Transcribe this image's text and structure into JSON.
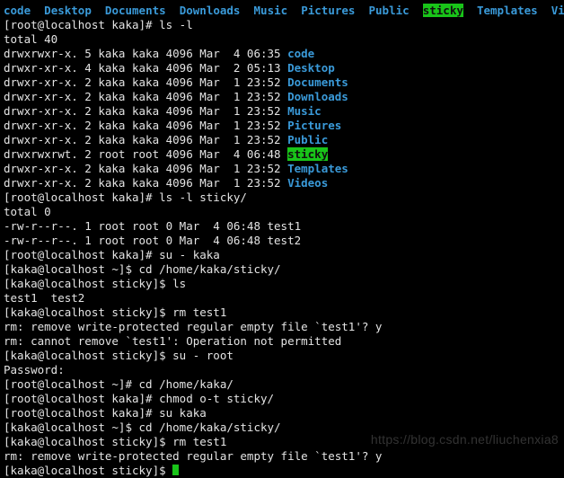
{
  "header_dirs": [
    "code",
    "Desktop",
    "Documents",
    "Downloads",
    "Music",
    "Pictures",
    "Public",
    "sticky",
    "Templates",
    "Videos"
  ],
  "prompts": {
    "root_kaka": "[root@localhost kaka]# ",
    "root_home": "[root@localhost ~]# ",
    "kaka_home": "[kaka@localhost ~]$ ",
    "kaka_sticky": "[kaka@localhost sticky]$ "
  },
  "cmds": {
    "ls_l": "ls -l",
    "ls_l_sticky": "ls -l sticky/",
    "su_kaka": "su - kaka",
    "cd_sticky_full": "cd /home/kaka/sticky/",
    "ls": "ls",
    "rm_test1": "rm test1",
    "su_root": "su - root",
    "cd_home_kaka": "cd /home/kaka/",
    "chmod": "chmod o-t sticky/",
    "su_kaka2": "su kaka"
  },
  "ls_output": {
    "total": "total 40",
    "rows": [
      {
        "perm": "drwxrwxr-x.",
        "n": "5",
        "own": "kaka kaka",
        "size": "4096",
        "date": "Mar  4 06:35",
        "name": "code",
        "cls": "blue-b"
      },
      {
        "perm": "drwxr-xr-x.",
        "n": "4",
        "own": "kaka kaka",
        "size": "4096",
        "date": "Mar  2 05:13",
        "name": "Desktop",
        "cls": "blue-b"
      },
      {
        "perm": "drwxr-xr-x.",
        "n": "2",
        "own": "kaka kaka",
        "size": "4096",
        "date": "Mar  1 23:52",
        "name": "Documents",
        "cls": "blue-b"
      },
      {
        "perm": "drwxr-xr-x.",
        "n": "2",
        "own": "kaka kaka",
        "size": "4096",
        "date": "Mar  1 23:52",
        "name": "Downloads",
        "cls": "blue-b"
      },
      {
        "perm": "drwxr-xr-x.",
        "n": "2",
        "own": "kaka kaka",
        "size": "4096",
        "date": "Mar  1 23:52",
        "name": "Music",
        "cls": "blue-b"
      },
      {
        "perm": "drwxr-xr-x.",
        "n": "2",
        "own": "kaka kaka",
        "size": "4096",
        "date": "Mar  1 23:52",
        "name": "Pictures",
        "cls": "blue-b"
      },
      {
        "perm": "drwxr-xr-x.",
        "n": "2",
        "own": "kaka kaka",
        "size": "4096",
        "date": "Mar  1 23:52",
        "name": "Public",
        "cls": "blue-b"
      },
      {
        "perm": "drwxrwxrwt.",
        "n": "2",
        "own": "root root",
        "size": "4096",
        "date": "Mar  4 06:48",
        "name": "sticky",
        "cls": "hl-sticky"
      },
      {
        "perm": "drwxr-xr-x.",
        "n": "2",
        "own": "kaka kaka",
        "size": "4096",
        "date": "Mar  1 23:52",
        "name": "Templates",
        "cls": "blue-b"
      },
      {
        "perm": "drwxr-xr-x.",
        "n": "2",
        "own": "kaka kaka",
        "size": "4096",
        "date": "Mar  1 23:52",
        "name": "Videos",
        "cls": "blue-b"
      }
    ]
  },
  "ls_sticky": {
    "total": "total 0",
    "rows": [
      {
        "perm": "-rw-r--r--.",
        "n": "1",
        "own": "root root",
        "size": "0",
        "date": "Mar  4 06:48",
        "name": "test1"
      },
      {
        "perm": "-rw-r--r--.",
        "n": "1",
        "own": "root root",
        "size": "0",
        "date": "Mar  4 06:48",
        "name": "test2"
      }
    ]
  },
  "ls_dir_out": "test1  test2",
  "rm_prompt1": "rm: remove write-protected regular empty file `test1'? y",
  "rm_error": "rm: cannot remove `test1': Operation not permitted",
  "password": "Password:",
  "rm_prompt2": "rm: remove write-protected regular empty file `test1'? y",
  "watermark": "https://blog.csdn.net/liuchenxia8"
}
